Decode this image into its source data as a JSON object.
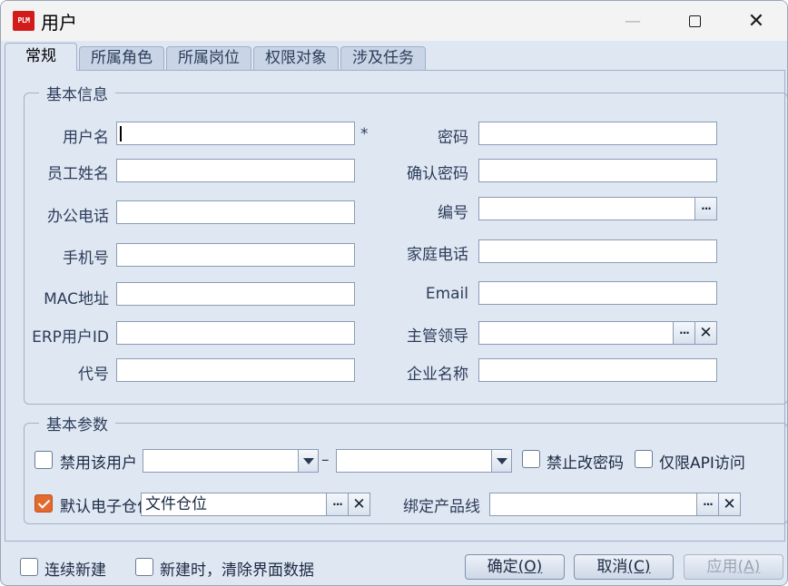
{
  "window": {
    "app_icon_text": "PLM",
    "title": "用户"
  },
  "tabs": [
    {
      "label": "常规",
      "active": true
    },
    {
      "label": "所属角色",
      "active": false
    },
    {
      "label": "所属岗位",
      "active": false
    },
    {
      "label": "权限对象",
      "active": false
    },
    {
      "label": "涉及任务",
      "active": false
    }
  ],
  "basic_info": {
    "legend": "基本信息",
    "username": {
      "label": "用户名",
      "value": "",
      "required_mark": "*"
    },
    "employee_name": {
      "label": "员工姓名",
      "value": ""
    },
    "office_phone": {
      "label": "办公电话",
      "value": ""
    },
    "mobile": {
      "label": "手机号",
      "value": ""
    },
    "mac_address": {
      "label": "MAC地址",
      "value": ""
    },
    "erp_user_id": {
      "label": "ERP用户ID",
      "value": ""
    },
    "code": {
      "label": "代号",
      "value": ""
    },
    "password": {
      "label": "密码",
      "value": ""
    },
    "confirm_password": {
      "label": "确认密码",
      "value": ""
    },
    "number": {
      "label": "编号",
      "value": "",
      "browse_label": "···"
    },
    "home_phone": {
      "label": "家庭电话",
      "value": ""
    },
    "email": {
      "label": "Email",
      "value": ""
    },
    "supervisor": {
      "label": "主管领导",
      "value": "",
      "browse_label": "···",
      "clear_label": "✕"
    },
    "company_name": {
      "label": "企业名称",
      "value": ""
    }
  },
  "basic_params": {
    "legend": "基本参数",
    "disable_user": {
      "label": "禁用该用户",
      "checked": false
    },
    "date_from": {
      "value": ""
    },
    "date_separator": "–",
    "date_to": {
      "value": ""
    },
    "no_change_password": {
      "label": "禁止改密码",
      "checked": false
    },
    "api_only": {
      "label": "仅限API访问",
      "checked": false
    },
    "default_e_warehouse": {
      "label": "默认电子仓位",
      "checked": true,
      "value": "文件仓位",
      "browse_label": "···",
      "clear_label": "✕"
    },
    "bind_product_line": {
      "label": "绑定产品线",
      "value": "",
      "browse_label": "···",
      "clear_label": "✕"
    }
  },
  "footer": {
    "continuous_create": {
      "label": "连续新建",
      "checked": false
    },
    "clear_on_new": {
      "label": "新建时，清除界面数据",
      "checked": false
    },
    "ok": {
      "label": "确定",
      "mnemonic": "(O)"
    },
    "cancel": {
      "label": "取消",
      "mnemonic": "(C)"
    },
    "apply": {
      "label": "应用",
      "mnemonic": "(A)"
    }
  },
  "colors": {
    "background": "#dfe7f2",
    "field_border": "#8b9cb4",
    "checkbox_checked": "#e36a2e",
    "app_icon": "#d21c1c"
  }
}
